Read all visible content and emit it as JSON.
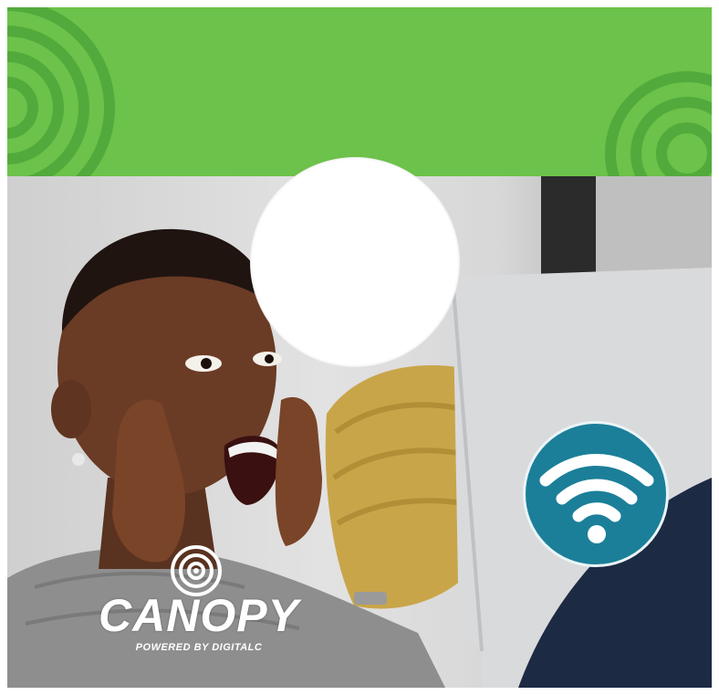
{
  "colors": {
    "band_green": "#6cc24a",
    "ring_green": "#4ea63a",
    "wifi_badge_teal": "#1b7f99",
    "logo_white": "#ffffff"
  },
  "icons": {
    "wifi_badge": "wifi-icon",
    "logo_mark": "signal-rings-icon",
    "corner_rings": "concentric-rings-icon"
  },
  "logo": {
    "name": "CANOPY",
    "tagline": "POWERED BY DIGITALC"
  }
}
